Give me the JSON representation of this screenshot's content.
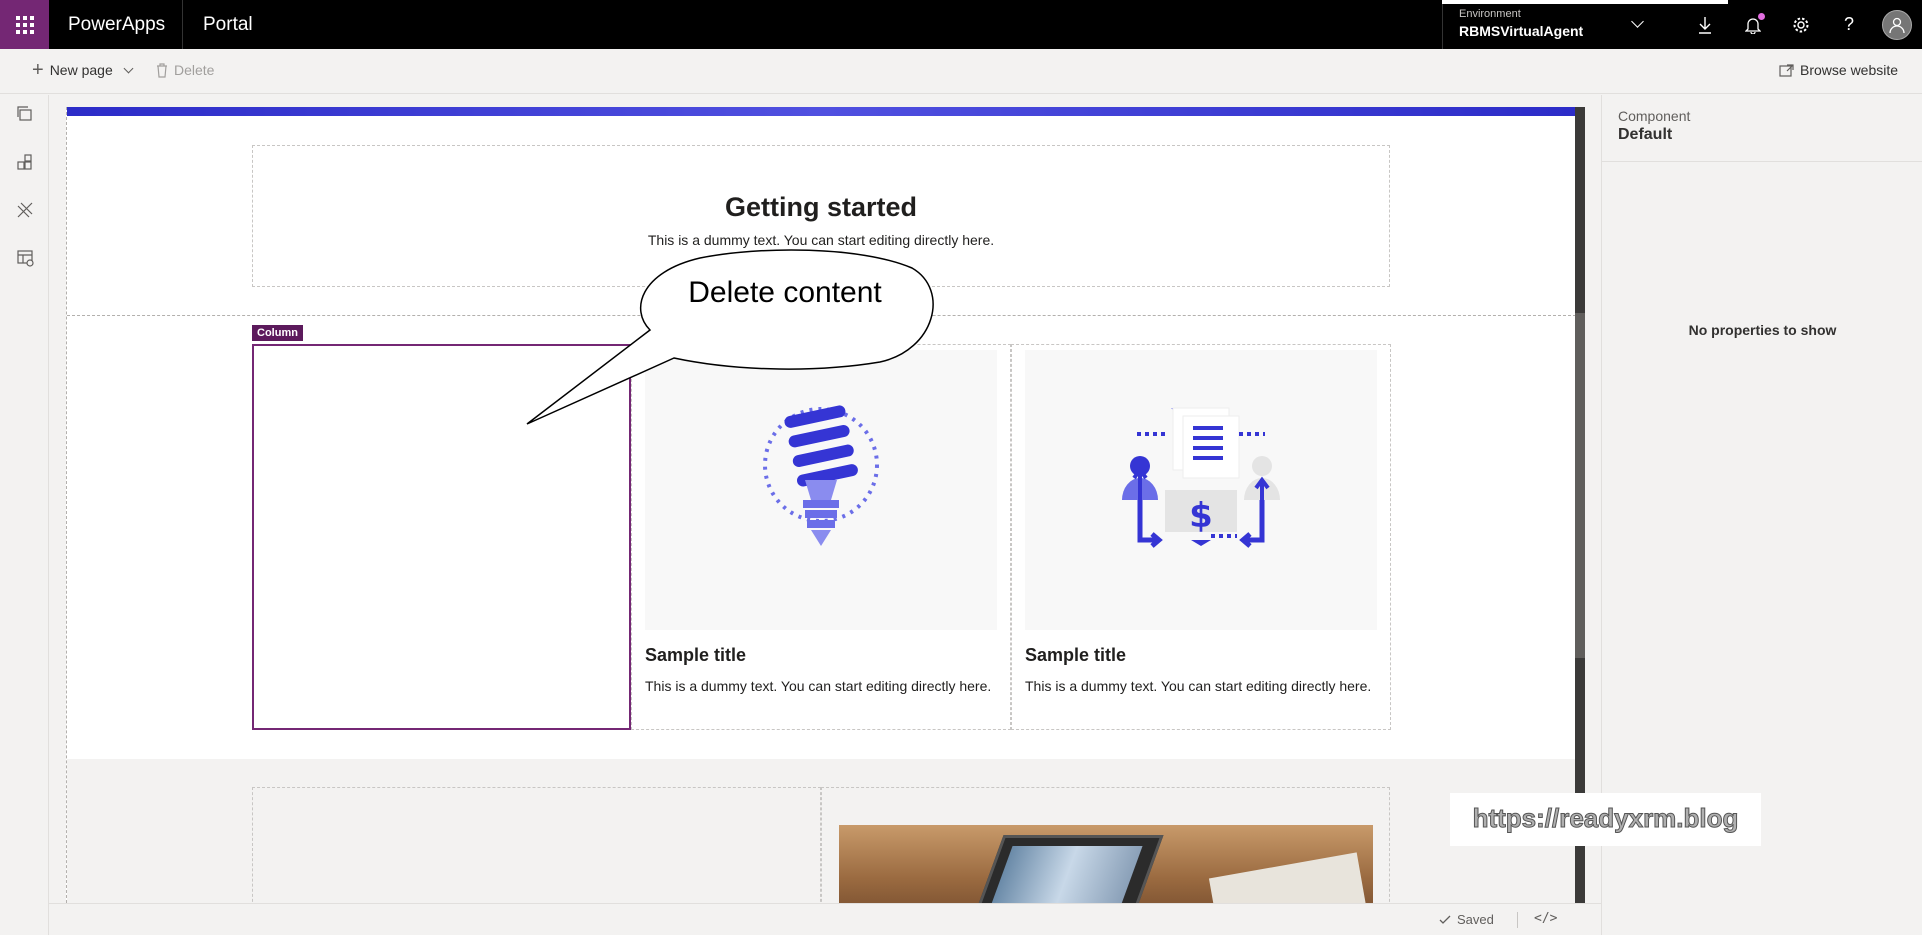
{
  "topbar": {
    "app_name": "PowerApps",
    "portal_name": "Portal",
    "environment_label": "Environment",
    "environment_value": "RBMSVirtualAgent"
  },
  "cmdbar": {
    "new_page": "New page",
    "delete": "Delete",
    "browse_website": "Browse website"
  },
  "canvas": {
    "hero_title": "Getting started",
    "hero_text": "This is a dummy text. You can start editing directly here.",
    "column_tag": "Column",
    "cards": [
      {
        "title": "Sample title",
        "text": "This is a dummy text. You can start editing directly here.",
        "icon": "lightbulb-icon"
      },
      {
        "title": "Sample title",
        "text": "This is a dummy text. You can start editing directly here.",
        "icon": "finance-network-icon"
      }
    ]
  },
  "callout": {
    "text": "Delete content"
  },
  "status": {
    "saved": "Saved",
    "code": "</>"
  },
  "right_panel": {
    "label": "Component",
    "value": "Default",
    "empty": "No properties to show"
  },
  "watermark": "https://readyxrm.blog",
  "colors": {
    "brand": "#742774",
    "accent": "#2c2cc8"
  }
}
